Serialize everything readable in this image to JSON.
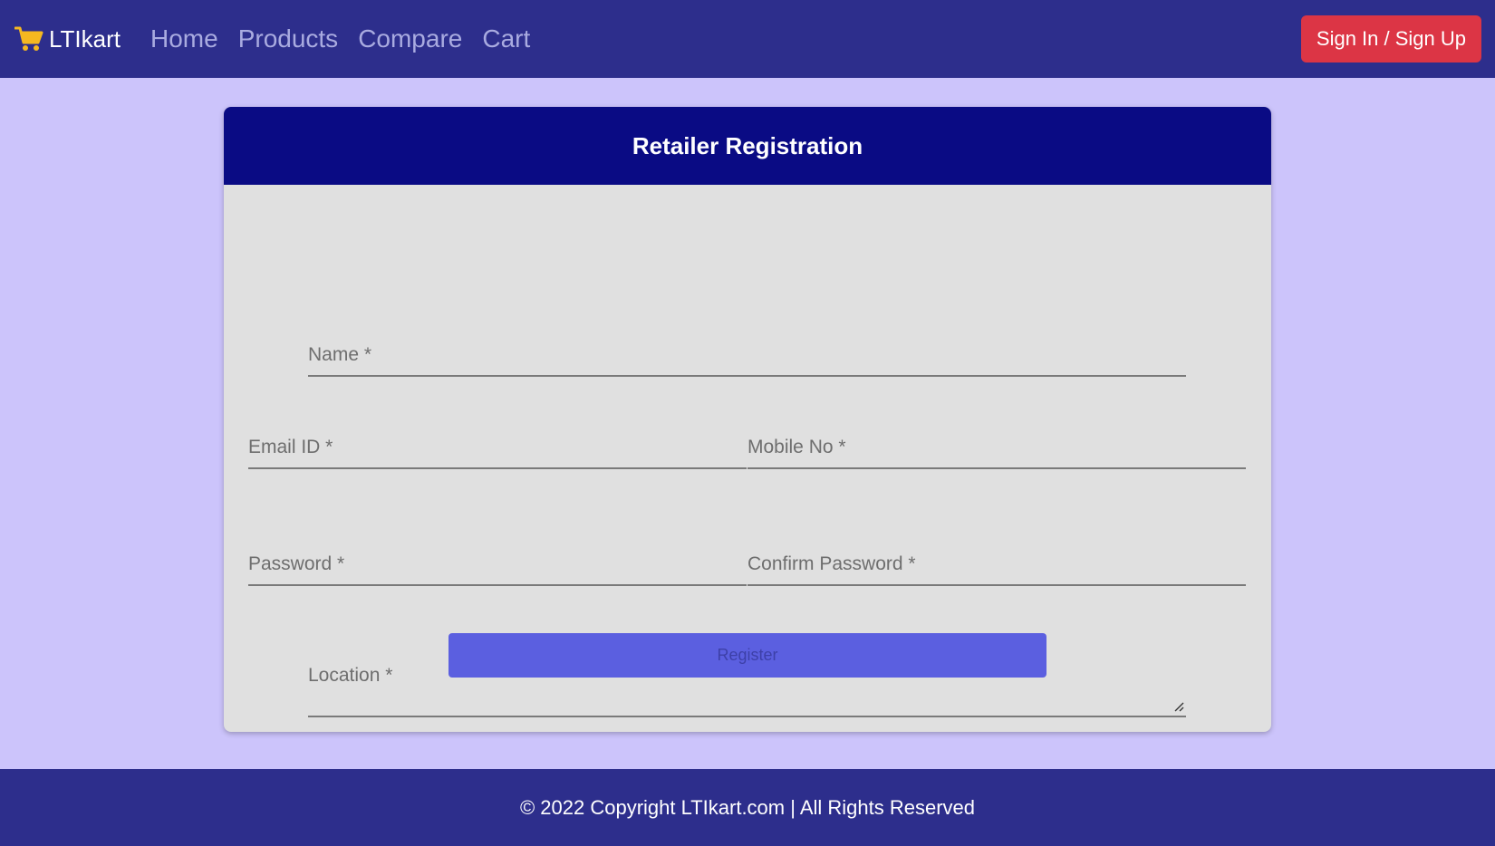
{
  "navbar": {
    "brand": "LTIkart",
    "brand_icon": "cart-icon",
    "links": [
      "Home",
      "Products",
      "Compare",
      "Cart"
    ],
    "signin_label": "Sign In / Sign Up",
    "colors": {
      "background": "#2d2e8c",
      "link": "#a9abe0",
      "signin": "#dc3545",
      "cart_icon": "#f5b820"
    }
  },
  "form": {
    "title": "Retailer Registration",
    "fields": {
      "name": "Name *",
      "email": "Email ID *",
      "mobile": "Mobile No *",
      "password": "Password *",
      "confirm_password": "Confirm Password *",
      "location": "Location *"
    },
    "register_label": "Register",
    "colors": {
      "header": "#0a0b84",
      "card": "#e0e0e0",
      "register": "#5b5fe0"
    }
  },
  "footer": {
    "text": "© 2022 Copyright LTIkart.com | All Rights Reserved"
  },
  "page": {
    "background": "#ccc4fb"
  }
}
